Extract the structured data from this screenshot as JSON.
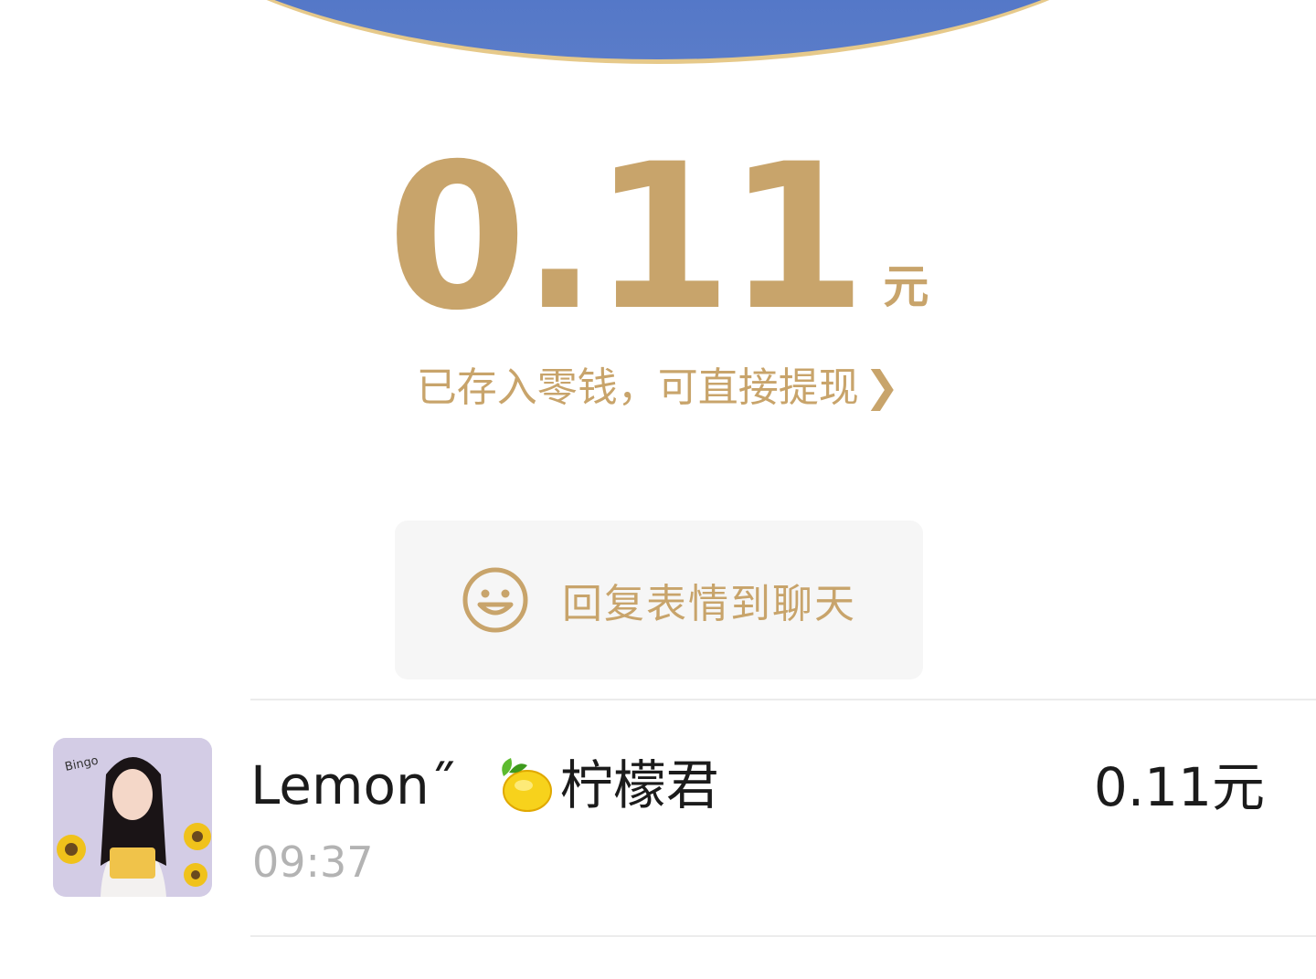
{
  "header": {
    "amount": "0.11",
    "unit": "元",
    "deposit_text": "已存入零钱，可直接提现",
    "deposit_chevron": "chevron-right-icon"
  },
  "reply_card": {
    "icon": "smile-icon",
    "label": "回复表情到聊天"
  },
  "record": {
    "avatar": "avatar",
    "avatar_caption": "Bingo",
    "name_latin": "Lemon˝",
    "name_icon": "lemon-emoji-icon",
    "name_cn": "柠檬君",
    "time": "09:37",
    "amount": "0.11元"
  },
  "colors": {
    "gold": "#c8a46b",
    "top_blue": "#4f74c6",
    "top_border": "#e6c98a",
    "card_bg": "#f6f6f6",
    "text_dark": "#1b1b1b",
    "text_muted": "#b3b3b3"
  }
}
